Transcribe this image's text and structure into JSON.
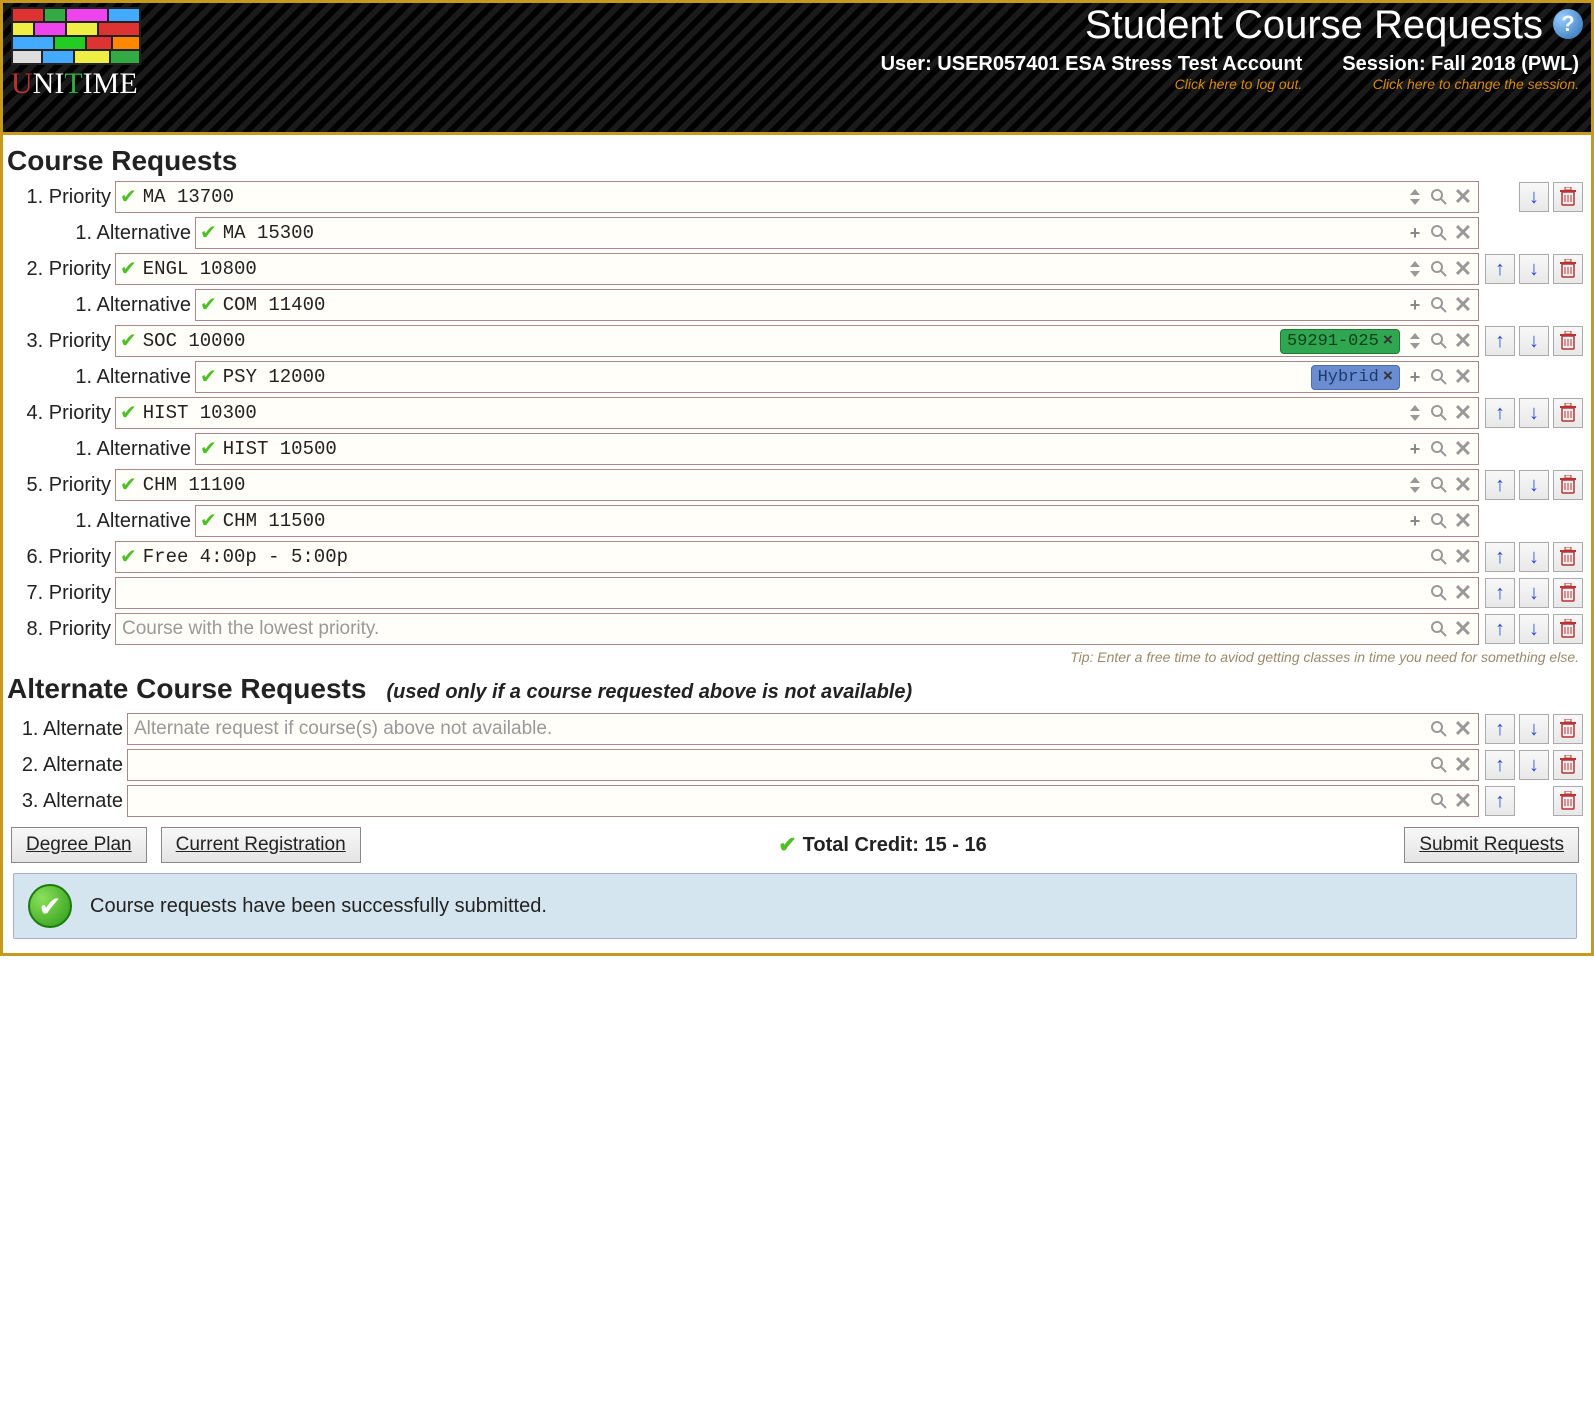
{
  "header": {
    "title": "Student Course Requests",
    "user_label": "User: USER057401 ESA Stress Test Account",
    "user_sub": "Click here to log out.",
    "session_label": "Session: Fall 2018 (PWL)",
    "session_sub": "Click here to change the session.",
    "logo_text_u": "U",
    "logo_text_ni": "NI",
    "logo_text_t": "T",
    "logo_text_ime": "IME"
  },
  "sections": {
    "course_requests": "Course Requests",
    "alt_requests": "Alternate Course Requests",
    "alt_sub": "(used only if a course requested above is not available)"
  },
  "rows": [
    {
      "label": "1. Priority",
      "type": "pri",
      "value": "MA 13700",
      "check": true,
      "icons": [
        "sort",
        "search",
        "clear"
      ],
      "side": [
        "",
        "down",
        "trash"
      ]
    },
    {
      "label": "1. Alternative",
      "type": "alt",
      "value": "MA 15300",
      "check": true,
      "icons": [
        "plus",
        "search",
        "clear"
      ],
      "side": []
    },
    {
      "label": "2. Priority",
      "type": "pri",
      "value": "ENGL 10800",
      "check": true,
      "icons": [
        "sort",
        "search",
        "clear"
      ],
      "side": [
        "up",
        "down",
        "trash"
      ]
    },
    {
      "label": "1. Alternative",
      "type": "alt",
      "value": "COM 11400",
      "check": true,
      "icons": [
        "plus",
        "search",
        "clear"
      ],
      "side": []
    },
    {
      "label": "3. Priority",
      "type": "pri",
      "value": "SOC 10000",
      "check": true,
      "chip": {
        "text": "59291-025",
        "style": "green"
      },
      "icons": [
        "sort",
        "search",
        "clear"
      ],
      "side": [
        "up",
        "down",
        "trash"
      ]
    },
    {
      "label": "1. Alternative",
      "type": "alt",
      "value": "PSY 12000",
      "check": true,
      "chip": {
        "text": "Hybrid",
        "style": "blue"
      },
      "icons": [
        "plus",
        "search",
        "clear"
      ],
      "side": []
    },
    {
      "label": "4. Priority",
      "type": "pri",
      "value": "HIST 10300",
      "check": true,
      "icons": [
        "sort",
        "search",
        "clear"
      ],
      "side": [
        "up",
        "down",
        "trash"
      ]
    },
    {
      "label": "1. Alternative",
      "type": "alt",
      "value": "HIST 10500",
      "check": true,
      "icons": [
        "plus",
        "search",
        "clear"
      ],
      "side": []
    },
    {
      "label": "5. Priority",
      "type": "pri",
      "value": "CHM 11100",
      "check": true,
      "icons": [
        "sort",
        "search",
        "clear"
      ],
      "side": [
        "up",
        "down",
        "trash"
      ]
    },
    {
      "label": "1. Alternative",
      "type": "alt",
      "value": "CHM 11500",
      "check": true,
      "icons": [
        "plus",
        "search",
        "clear"
      ],
      "side": []
    },
    {
      "label": "6. Priority",
      "type": "pri",
      "value": "Free 4:00p - 5:00p",
      "check": true,
      "icons": [
        "search",
        "clear"
      ],
      "side": [
        "up",
        "down",
        "trash"
      ]
    },
    {
      "label": "7. Priority",
      "type": "pri",
      "value": "",
      "check": false,
      "icons": [
        "search",
        "clear"
      ],
      "side": [
        "up",
        "down",
        "trash"
      ]
    },
    {
      "label": "8. Priority",
      "type": "pri",
      "value": "",
      "placeholder": "Course with the lowest priority.",
      "check": false,
      "icons": [
        "search",
        "clear"
      ],
      "side": [
        "up",
        "down",
        "trash"
      ]
    }
  ],
  "tip": "Tip: Enter a free time to aviod getting classes in time you need for something else.",
  "alt_rows": [
    {
      "label": "1. Alternate",
      "value": "",
      "placeholder": "Alternate request if course(s) above not available.",
      "icons": [
        "search",
        "clear"
      ],
      "side": [
        "up",
        "down",
        "trash"
      ]
    },
    {
      "label": "2. Alternate",
      "value": "",
      "icons": [
        "search",
        "clear"
      ],
      "side": [
        "up",
        "down",
        "trash"
      ]
    },
    {
      "label": "3. Alternate",
      "value": "",
      "icons": [
        "search",
        "clear"
      ],
      "side": [
        "up",
        "",
        "trash"
      ]
    }
  ],
  "footer": {
    "degree_plan": "Degree Plan",
    "current_reg": "Current Registration",
    "credit": "Total Credit: 15 - 16",
    "submit": "Submit Requests"
  },
  "message": "Course requests have been successfully submitted.",
  "chip_x": "×"
}
